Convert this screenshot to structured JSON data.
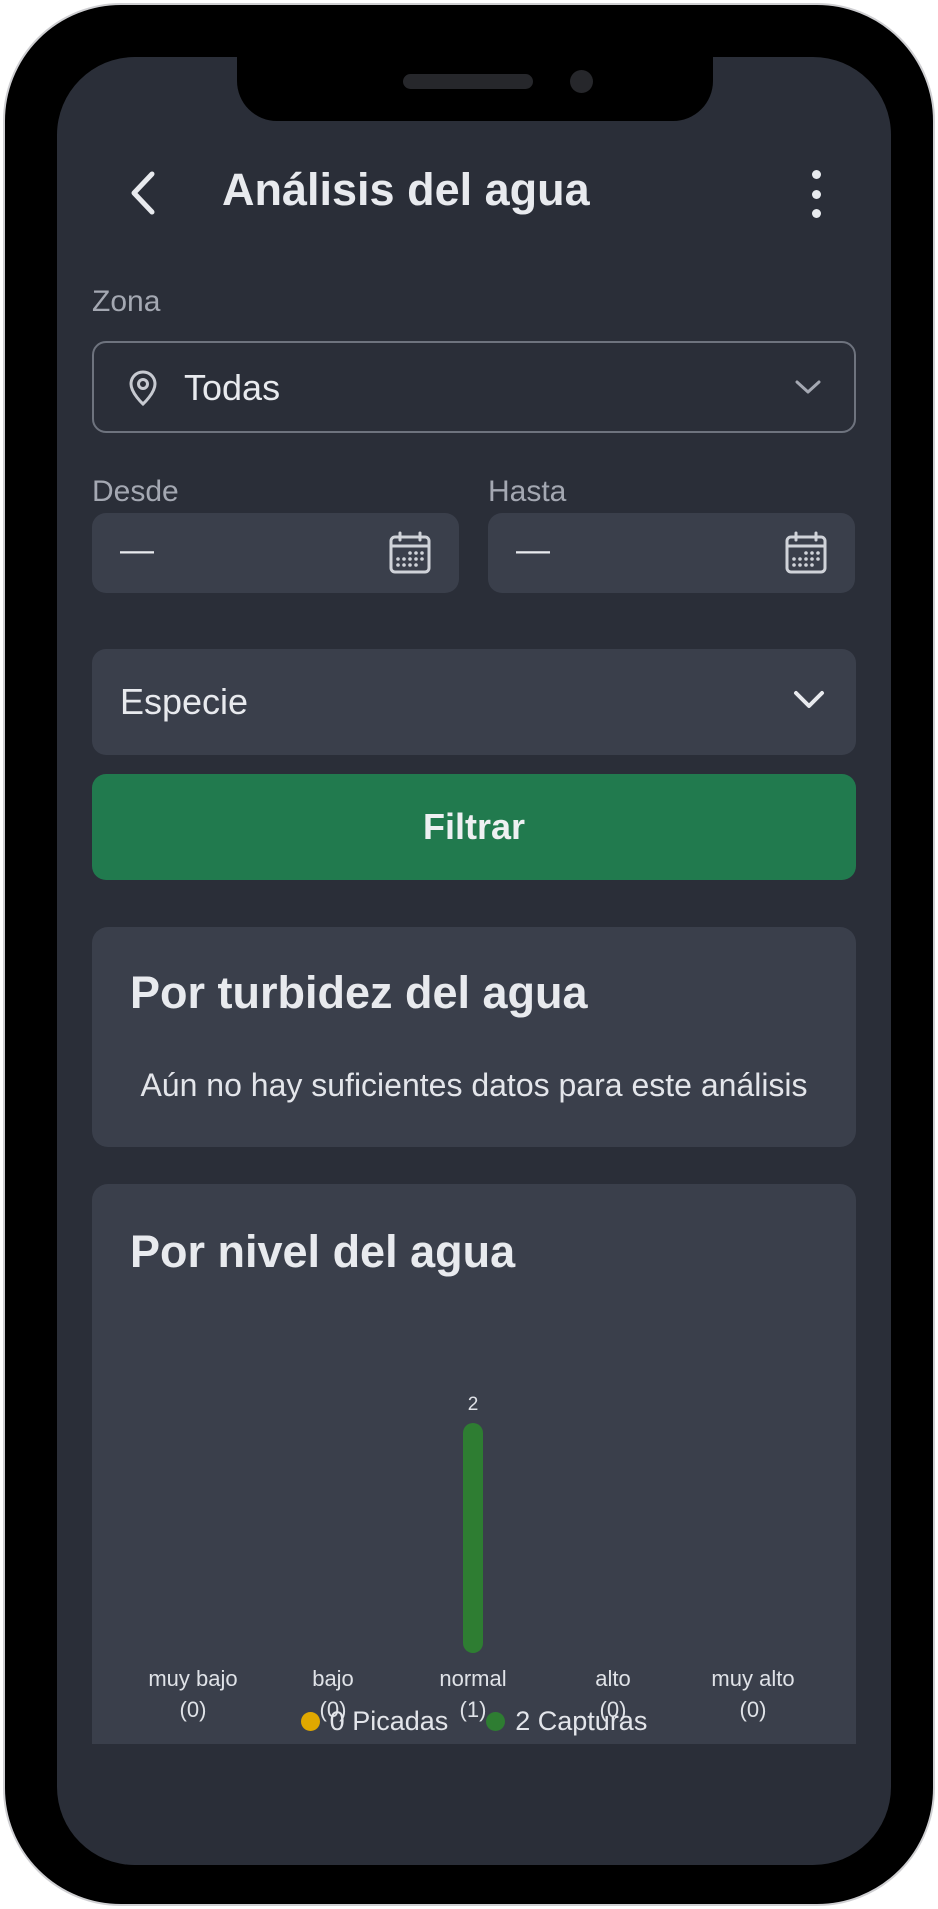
{
  "header": {
    "title": "Análisis del agua",
    "back_icon": "chevron-left-icon",
    "more_icon": "more-vertical-icon"
  },
  "filters": {
    "zona_label": "Zona",
    "zona_value": "Todas",
    "desde_label": "Desde",
    "desde_value": "—",
    "hasta_label": "Hasta",
    "hasta_value": "—",
    "especie_label": "Especie",
    "filter_button": "Filtrar"
  },
  "cards": {
    "turbidez": {
      "title": "Por turbidez del agua",
      "empty_message": "Aún no hay suficientes datos para este análisis"
    },
    "nivel": {
      "title": "Por nivel del agua"
    }
  },
  "colors": {
    "background": "#2a2e38",
    "card": "#3a3f4b",
    "accent_button": "#217a4e",
    "capturas": "#2e7d32",
    "picadas": "#e0a800"
  },
  "chart_data": {
    "type": "bar",
    "categories": [
      "muy bajo",
      "bajo",
      "normal",
      "alto",
      "muy alto"
    ],
    "category_counts": [
      "(0)",
      "(0)",
      "(1)",
      "(0)",
      "(0)"
    ],
    "series": [
      {
        "name": "Picadas",
        "values": [
          0,
          0,
          0,
          0,
          0
        ],
        "color": "#e0a800"
      },
      {
        "name": "Capturas",
        "values": [
          0,
          0,
          2,
          0,
          0
        ],
        "color": "#2e7d32"
      }
    ],
    "legend": [
      "0 Picadas",
      "2 Capturas"
    ],
    "ylim": [
      0,
      2
    ],
    "legend_placement": "bottom",
    "grid": false
  }
}
